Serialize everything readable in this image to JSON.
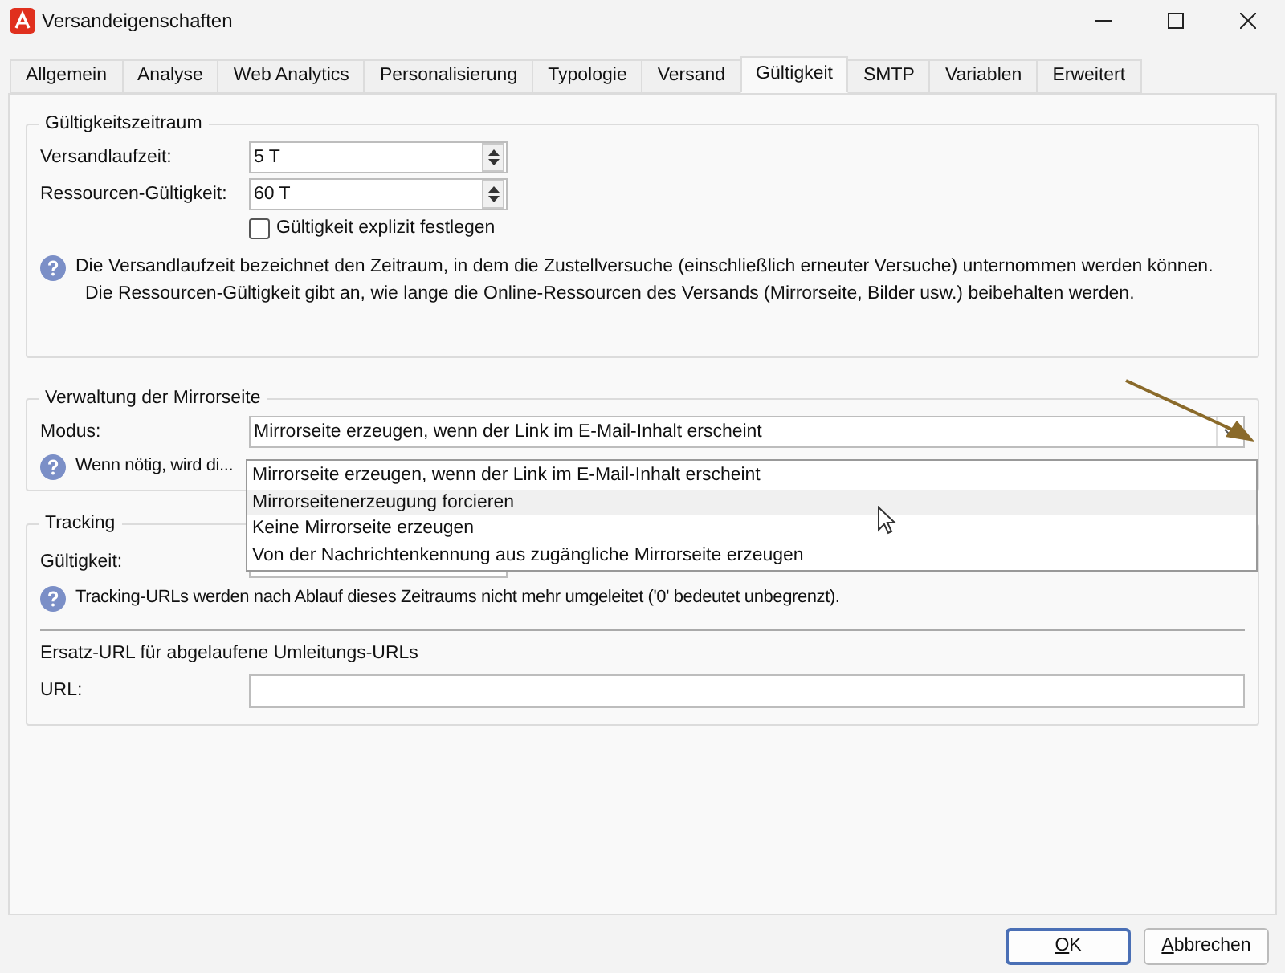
{
  "window": {
    "title": "Versandeigenschaften"
  },
  "tabs": [
    {
      "label": "Allgemein",
      "selected": false
    },
    {
      "label": "Analyse",
      "selected": false
    },
    {
      "label": "Web Analytics",
      "selected": false
    },
    {
      "label": "Personalisierung",
      "selected": false
    },
    {
      "label": "Typologie",
      "selected": false
    },
    {
      "label": "Versand",
      "selected": false
    },
    {
      "label": "Gültigkeit",
      "selected": true
    },
    {
      "label": "SMTP",
      "selected": false
    },
    {
      "label": "Variablen",
      "selected": false
    },
    {
      "label": "Erweitert",
      "selected": false
    }
  ],
  "validity_period": {
    "title": "Gültigkeitszeitraum",
    "fields": [
      {
        "label": "Versandlaufzeit:",
        "value": "5 T"
      },
      {
        "label": "Ressourcen-Gültigkeit:",
        "value": "60 T"
      }
    ],
    "checkbox": {
      "label": "Gültigkeit explizit festlegen",
      "checked": false
    },
    "help": [
      "Die Versandlaufzeit bezeichnet den Zeitraum, in dem die Zustellversuche (einschließlich erneuter Versuche) unternommen werden können.",
      "Die Ressourcen-Gültigkeit gibt an, wie lange die Online-Ressourcen des Versands (Mirrorseite, Bilder usw.) beibehalten werden."
    ]
  },
  "mirror_page": {
    "title": "Verwaltung der Mirrorseite",
    "label": "Modus:",
    "value": "Mirrorseite erzeugen, wenn der Link im E-Mail-Inhalt erscheint",
    "help": "Wenn nötig, wird di...",
    "options": [
      {
        "label": "Mirrorseite erzeugen, wenn der Link im E-Mail-Inhalt erscheint",
        "highlighted": false
      },
      {
        "label": "Mirrorseitenerzeugung forcieren",
        "highlighted": true
      },
      {
        "label": "Keine Mirrorseite erzeugen",
        "highlighted": false
      },
      {
        "label": "Von der Nachrichtenkennung aus zugängliche Mirrorseite erzeugen",
        "highlighted": false
      }
    ]
  },
  "tracking": {
    "title": "Tracking",
    "label": "Gültigkeit:",
    "help": "Tracking-URLs werden nach Ablauf dieses Zeitraums nicht mehr umgeleitet ('0' bedeutet unbegrenzt).",
    "fallback_title": "Ersatz-URL für abgelaufene Umleitungs-URLs",
    "url_label": "URL:"
  },
  "buttons": [
    {
      "label": "OK",
      "default": true
    },
    {
      "label": "Abbrechen",
      "default": false
    }
  ]
}
